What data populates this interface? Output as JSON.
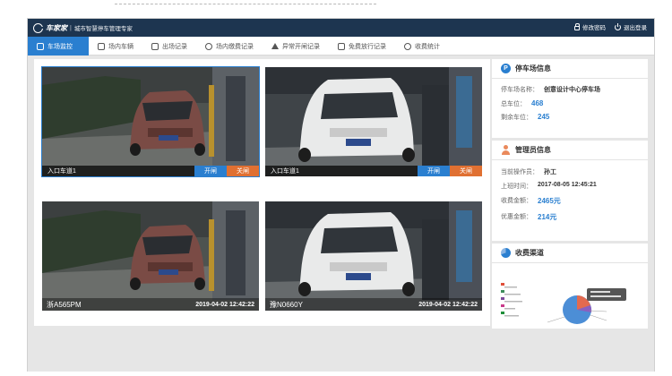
{
  "header": {
    "brand": "车家家",
    "subtitle": "城市智慧停车管理专家",
    "actions": [
      {
        "icon": "lock-icon",
        "label": "修改密码"
      },
      {
        "icon": "power-icon",
        "label": "退出登录"
      }
    ]
  },
  "nav": [
    {
      "label": "车场监控",
      "icon": "home-icon",
      "active": true
    },
    {
      "label": "场内车辆",
      "icon": "car-icon",
      "active": false
    },
    {
      "label": "出场记录",
      "icon": "record-icon",
      "active": false
    },
    {
      "label": "场内缴费记录",
      "icon": "coin-icon",
      "active": false
    },
    {
      "label": "异常开闸记录",
      "icon": "warning-icon",
      "active": false
    },
    {
      "label": "免费放行记录",
      "icon": "edit-icon",
      "active": false
    },
    {
      "label": "收费统计",
      "icon": "stats-icon",
      "active": false
    }
  ],
  "cameras": [
    {
      "channel": "入口车道1",
      "open_label": "开闸",
      "close_label": "关闸",
      "selected": true
    },
    {
      "channel": "入口车道1",
      "open_label": "开闸",
      "close_label": "关闸",
      "selected": false
    },
    {
      "plate": "浙A565PM",
      "timestamp": "2019-04-02 12:42:22"
    },
    {
      "plate": "豫N0660Y",
      "timestamp": "2019-04-02 12:42:22"
    }
  ],
  "lot_info": {
    "title": "停车场信息",
    "name_label": "停车场名称：",
    "name_value": "创意设计中心停车场",
    "total_label": "总车位：",
    "total_value": "468",
    "free_label": "剩余车位：",
    "free_value": "245"
  },
  "operator": {
    "title": "管理员信息",
    "current_label": "当前操作员：",
    "current_value": "孙工",
    "shift_label": "上班时间：",
    "shift_value": "2017-08-05  12:45:21",
    "fee_label": "收费金额：",
    "fee_value": "2465元",
    "discount_label": "优惠金额：",
    "discount_value": "214元"
  },
  "channels": {
    "title": "收费渠道"
  },
  "colors": {
    "topbar": "#1d3550",
    "accent": "#2a7fd0",
    "close": "#e07032"
  }
}
